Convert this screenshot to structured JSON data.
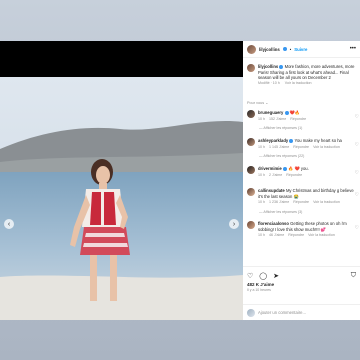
{
  "post": {
    "username": "lilyjcollins",
    "follow_label": "Suivre",
    "more_icon": "•••"
  },
  "caption": {
    "username": "lilyjcollins",
    "text": "More fashion, more adventures, more Paris! Sharing a first look at what's ahead... Final season will be all yours on December 2",
    "time": "Modifié · 10 h",
    "translate": "Voir la traduction"
  },
  "sort_label": "Pour vous ⌄",
  "comments": [
    {
      "user": "bruneguaery",
      "text": "❤️🔥",
      "time": "10 h",
      "likes": "152 J'aime",
      "reply": "Répondre",
      "replies": "Afficher les réponses (1)",
      "translate": ""
    },
    {
      "user": "ashleyparklady",
      "text": "You make my heart so ha",
      "time": "10 h",
      "likes": "1 145 J'aime",
      "reply": "Répondre",
      "replies": "Afficher les réponses (22)",
      "translate": "Voir la traduction"
    },
    {
      "user": "drivermimie",
      "text": "🔥 ❤️ you.",
      "time": "10 h",
      "likes": "2 J'aime",
      "reply": "Répondre",
      "replies": "",
      "translate": ""
    },
    {
      "user": "callinsupdate",
      "text": "My Christmas and birthday g believe it's the last season 😭",
      "time": "10 h",
      "likes": "1 236 J'aime",
      "reply": "Répondre",
      "replies": "Afficher les réponses (3)",
      "translate": "Voir la traduction"
    },
    {
      "user": "florenciaalonso",
      "text": "Getting these photos on oh i'm sobbing! I love this show much!!!! 💕",
      "time": "10 h",
      "likes": "46 J'aime",
      "reply": "Répondre",
      "replies": "",
      "translate": "Voir la traduction"
    }
  ],
  "footer": {
    "likes": "482 K J'aime",
    "date": "Il y a 10 heures",
    "add_comment": "Ajouter un commentaire..."
  },
  "colors": {
    "accent": "#0095f6",
    "verified": "#3897f0",
    "heart": "#ed4956"
  },
  "carousel": {
    "dots": 5,
    "active_dot": 1
  }
}
